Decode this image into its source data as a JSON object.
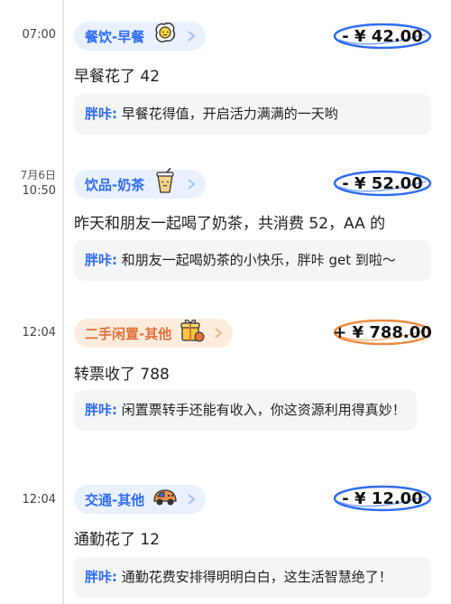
{
  "entries": [
    {
      "date": "",
      "time": "07:00",
      "category": "餐饮-早餐",
      "icon": "fried-egg-icon",
      "amount": "- ¥ 42.00",
      "type": "expense",
      "note": "早餐花了 42",
      "reply_author": "胖咔:",
      "reply_text": " 早餐花得值，开启活力满满的一天哟"
    },
    {
      "date": "7月6日",
      "time": "10:50",
      "category": "饮品-奶茶",
      "icon": "milk-tea-icon",
      "amount": "- ¥ 52.00",
      "type": "expense",
      "note": "昨天和朋友一起喝了奶茶，共消费 52，AA 的",
      "reply_author": "胖咔:",
      "reply_text": " 和朋友一起喝奶茶的小快乐，胖咔 get 到啦～"
    },
    {
      "date": "",
      "time": "12:04",
      "category": "二手闲置-其他",
      "icon": "gift-box-icon",
      "amount": "+ ¥ 788.00",
      "type": "income",
      "note": "转票收了 788",
      "reply_author": "胖咔:",
      "reply_text": " 闲置票转手还能有收入，你这资源利用得真妙！"
    },
    {
      "date": "",
      "time": "12:04",
      "category": "交通-其他",
      "icon": "car-icon",
      "amount": "- ¥ 12.00",
      "type": "expense",
      "note": "通勤花了 12",
      "reply_author": "胖咔:",
      "reply_text": " 通勤花费安排得明明白白，这生活智慧绝了！"
    }
  ],
  "colors": {
    "expense_ring": "#2f6df6",
    "income_ring": "#f08a3c",
    "accent": "#2f6df6"
  }
}
